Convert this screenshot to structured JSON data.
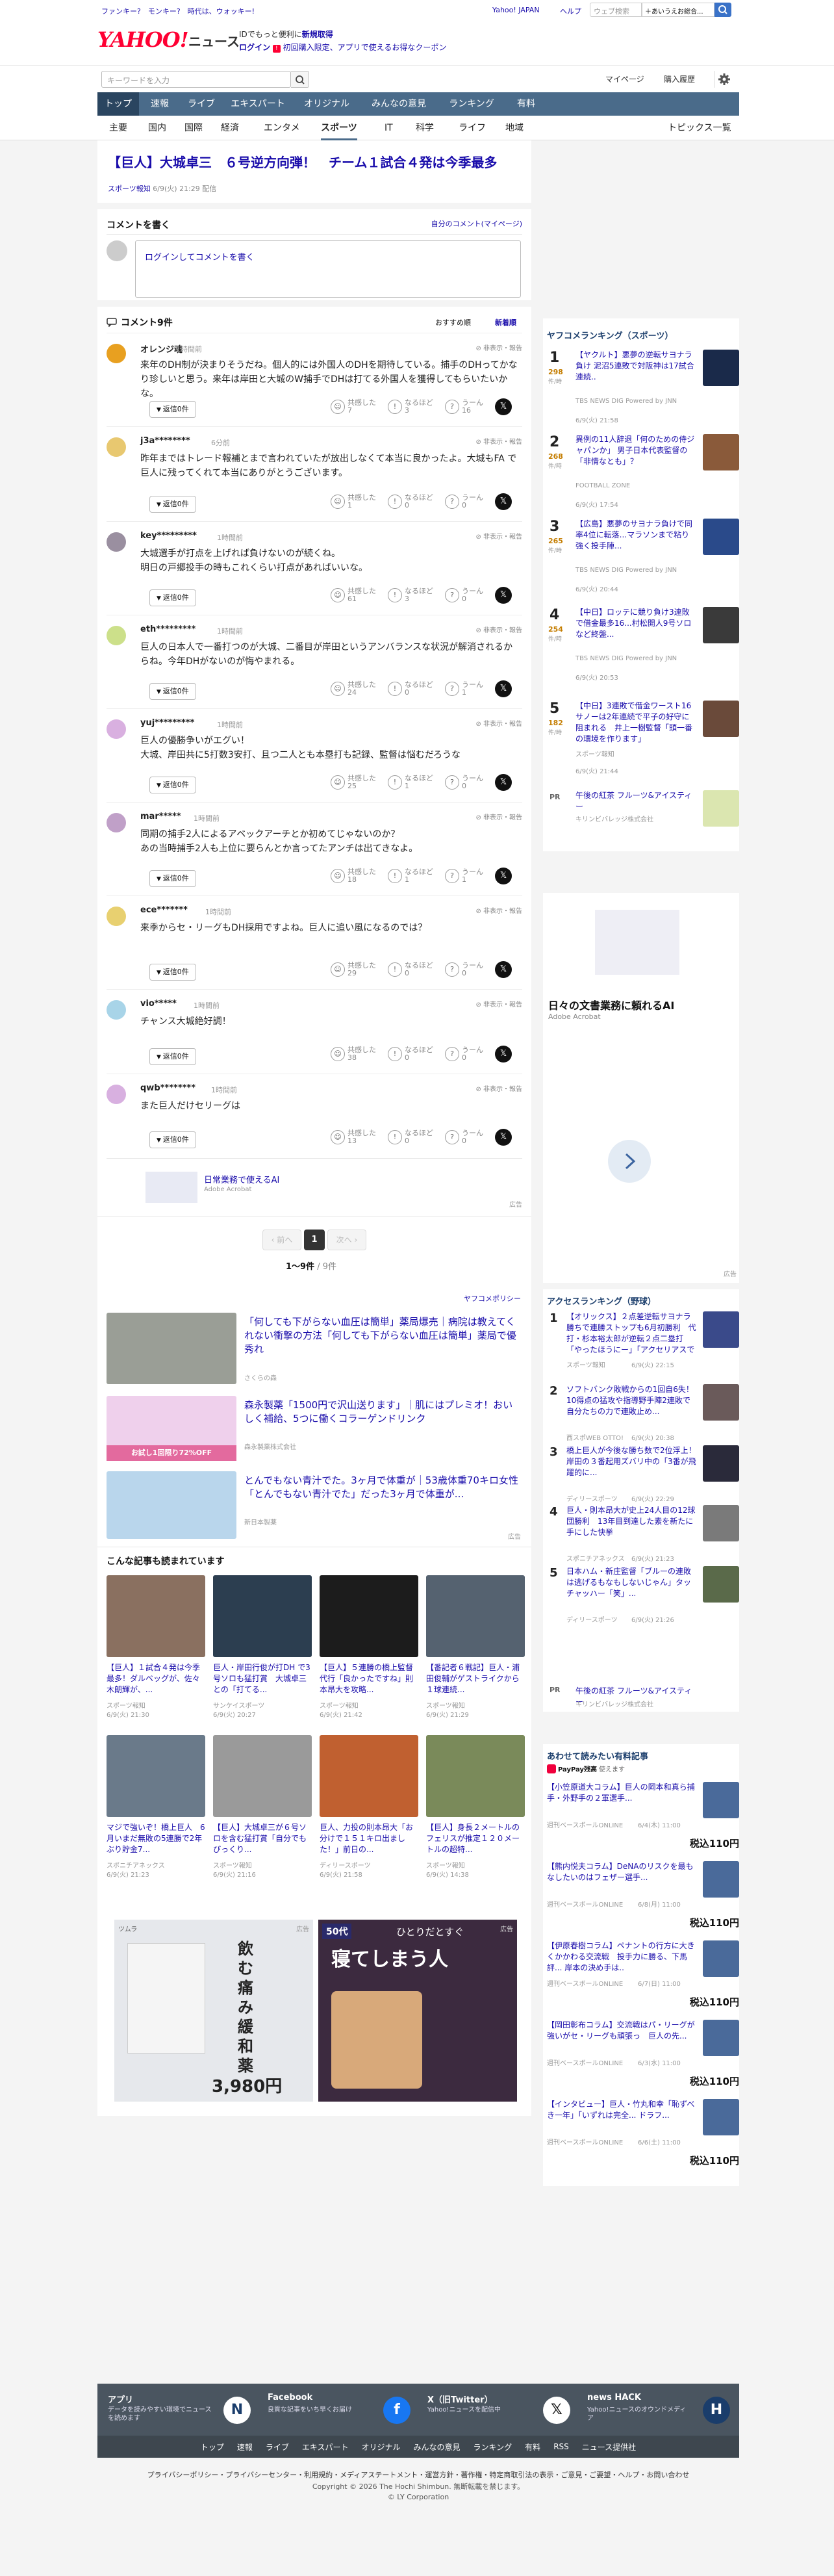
{
  "colors": {
    "nav": "#4a6b8a",
    "nav_active": "#2a4560",
    "brand": "#ff0033",
    "link": "#1a0dab",
    "rank_accent": "#c47d00",
    "footer": "#4a5560"
  },
  "topbar": {
    "promo": "ファンキー?　モンキー?　時代は、ウォッキー!",
    "links": [
      "Yahoo! JAPAN",
      "ヘルプ"
    ],
    "search_placeholder": "ウェブ検索",
    "search_select": "＋あいうえお総合...",
    "search_icon": "search-icon"
  },
  "header": {
    "logo": "YAHOO!",
    "logo_service": "ニュース",
    "promo_line1": "IDでもっと便利に",
    "promo_line1_em": "新規取得",
    "login_label": "ログイン",
    "promo_line2": "初回購入限定、アプリで使えるお得なクーポン"
  },
  "searchbar": {
    "placeholder": "キーワードを入力",
    "mypage": "マイページ",
    "purchase": "購入履歴",
    "settings_icon": "gear-icon"
  },
  "nav": [
    "トップ",
    "速報",
    "ライブ",
    "エキスパート",
    "オリジナル",
    "みんなの意見",
    "ランキング",
    "有料"
  ],
  "subnav": [
    "主要",
    "国内",
    "国際",
    "経済",
    "エンタメ",
    "スポーツ",
    "IT",
    "科学",
    "ライフ",
    "地域"
  ],
  "subnav_right": "トピックス一覧",
  "article": {
    "title": "【巨人】大城卓三　６号逆方向弾！　チーム１試合４発は今季最多",
    "source": "スポーツ報知",
    "date": "6/9(火) 21:29 配信"
  },
  "comment_form": {
    "heading": "コメントを書く",
    "my_comments": "自分のコメント(マイページ)",
    "login_prompt": "ログインしてコメントを書く"
  },
  "comments_header": {
    "title": "コメント9件",
    "sort_recommended": "おすすめ順",
    "sort_new": "新着順"
  },
  "comments": [
    {
      "name": "オレンジ魂",
      "time": "1時間前",
      "body": [
        "来年のDH制が決まりそうだね。個人的には外国人のDHを期待している。捕手のDHってかなり珍しいと思う。来年は岸田と大城のW捕手でDHは打てる外国人を獲得してもらいたいかな。"
      ],
      "agree": "7",
      "nahoto": "3",
      "unn": "16",
      "reply": "返信0件",
      "menu": "非表示・報告"
    },
    {
      "name": "j3a********",
      "time": "6分前",
      "body": [
        "昨年まではトレード報補とまで言われていたが放出しなくて本当に良かったよ。大城もFA で巨人に残ってくれて本当にありがとうございます。"
      ],
      "agree": "1",
      "nahoto": "0",
      "unn": "0",
      "reply": "返信0件",
      "menu": "非表示・報告"
    },
    {
      "name": "key*********",
      "time": "1時間前",
      "body": [
        "大城選手が打点を上げれば負けないのが続くね。",
        "明日の戸郷投手の時もこれくらい打点があればいいな。"
      ],
      "agree": "61",
      "nahoto": "3",
      "unn": "0",
      "reply": "返信0件",
      "menu": "非表示・報告"
    },
    {
      "name": "eth*********",
      "time": "1時間前",
      "body": [
        "巨人の日本人で一番打つのが大城、二番目が岸田というアンバランスな状況が解消されるからね。今年DHがないのが悔やまれる。"
      ],
      "agree": "24",
      "nahoto": "0",
      "unn": "1",
      "reply": "返信0件",
      "menu": "非表示・報告"
    },
    {
      "name": "yuj*********",
      "time": "1時間前",
      "body": [
        "巨人の優勝争いがエグい！",
        "大城、岸田共に5打数3安打、且つ二人とも本塁打も記録、監督は悩むだろうな"
      ],
      "agree": "25",
      "nahoto": "1",
      "unn": "0",
      "reply": "返信0件",
      "menu": "非表示・報告"
    },
    {
      "name": "mar*****",
      "time": "1時間前",
      "body": [
        "同期の捕手2人によるアベックアーチとか初めてじゃないのか？",
        "あの当時捕手2人も上位に要らんとか言ってたアンチは出てきなよ。"
      ],
      "agree": "18",
      "nahoto": "1",
      "unn": "1",
      "reply": "返信0件",
      "menu": "非表示・報告"
    },
    {
      "name": "ece*******",
      "time": "1時間前",
      "body": [
        "来季からセ・リーグもDH採用ですよね。巨人に追い風になるのでは？"
      ],
      "agree": "29",
      "nahoto": "0",
      "unn": "0",
      "reply": "返信0件",
      "menu": "非表示・報告"
    },
    {
      "name": "vio*****",
      "time": "1時間前",
      "body": [
        "チャンス大城絶好調！"
      ],
      "agree": "38",
      "nahoto": "0",
      "unn": "0",
      "reply": "返信0件",
      "menu": "非表示・報告"
    },
    {
      "name": "qwb********",
      "time": "1時間前",
      "body": [
        "また巨人だけセリーグは"
      ],
      "agree": "13",
      "nahoto": "0",
      "unn": "0",
      "reply": "返信0件",
      "menu": "非表示・報告"
    }
  ],
  "reaction_labels": {
    "agree": "共感した",
    "nahoto": "なるほど",
    "unn": "うーん"
  },
  "inline_ad": {
    "title": "日常業務で使えるAI",
    "source": "Adobe Acrobat",
    "ad_label": "広告"
  },
  "pagination": {
    "prev": "前へ",
    "current": "1",
    "next": "次へ",
    "summary": "1〜9件",
    "total": "/ 9件"
  },
  "yahoo_policy": "ヤフコメポリシー",
  "promos": [
    {
      "title": "「何しても下がらない血圧は簡単」薬局爆売｜病院は教えてくれない衝撃の方法「何しても下がらない血圧は簡単」薬局で優秀れ",
      "source": "さくらの森"
    },
    {
      "title": "森永製薬「1500円で沢山送ります」｜肌にはプレミオ！おいしく補給、5つに働くコラーゲンドリンク",
      "source": "森永製薬株式会社",
      "badge": "お試し1回限り72%OFF"
    },
    {
      "title": "とんでもない青汁でた。3ヶ月で体重が｜53歳体重70キロ女性「とんでもない青汁でた」だった3ヶ月で体重が...",
      "source": "新日本製薬"
    }
  ],
  "promo_ad_label": "広告",
  "related": {
    "heading": "こんな記事も読まれています",
    "items": [
      {
        "title": "【巨人】１試合４発は今季最多！ダルベッグが、佐々木朗輝が、...",
        "src": "スポーツ報知",
        "date": "6/9(火) 21:30"
      },
      {
        "title": "巨人・岸田行俊が打DH で3号ソロも猛打賞　大城卓三との「打てる...",
        "src": "サンケイスポーツ",
        "date": "6/9(火) 20:27"
      },
      {
        "title": "【巨人】５連勝の橋上監督代行「良かったですね」則本昂大を攻略...",
        "src": "スポーツ報知",
        "date": "6/9(火) 21:42"
      },
      {
        "title": "【番記者６戦記】巨人・浦田俊輔がゲストライクから１球連続...",
        "src": "スポーツ報知",
        "date": "6/9(火) 21:29"
      },
      {
        "title": "マジで強いぞ！橋上巨人　6月いまだ無敗の5連勝で2年ぶり貯金7...",
        "src": "スポニチアネックス",
        "date": "6/9(火) 21:23"
      },
      {
        "title": "【巨人】大城卓三が６号ソロを含む猛打賞「自分でもびっくり...",
        "src": "スポーツ報知",
        "date": "6/9(火) 21:16"
      },
      {
        "title": "巨人、力投の則本昂大「お分けで１５１キロ出ました！」前日の...",
        "src": "ディリースポーツ",
        "date": "6/9(火) 21:58"
      },
      {
        "title": "【巨人】身長２メートルのフェリスが推定１２０メートルの超特...",
        "src": "スポーツ報知",
        "date": "6/9(火) 14:38"
      }
    ]
  },
  "bottom_ads": [
    {
      "label": "広告",
      "brand": "ツムラ",
      "headline": "飲む痛み緩和薬",
      "price": "3,980円"
    },
    {
      "label": "広告",
      "age": "50代",
      "headline": "寝てしまう人",
      "sub": "ひとりだとすぐ"
    }
  ],
  "sidebar_ranking": {
    "heading": "ヤフコメランキング（スポーツ）",
    "unit": "件/時",
    "items": [
      {
        "rank": "1",
        "count": "298",
        "title": "【ヤクルト】悪夢の逆転サヨナラ負け 泥沼5連敗で対阪神は17試合連続..",
        "src": "TBS NEWS DIG Powered by JNN",
        "date": "6/9(火) 21:58"
      },
      {
        "rank": "2",
        "count": "268",
        "title": "異例の11人辞退「何のための侍ジャパンか」 男子日本代表監督の「非情なとも」？",
        "src": "FOOTBALL ZONE",
        "date": "6/9(火) 17:54"
      },
      {
        "rank": "3",
        "count": "265",
        "title": "【広島】悪夢のサヨナラ負けで同率4位に転落...マラソンまで粘り強く投手陣...",
        "src": "TBS NEWS DIG Powered by JNN",
        "date": "6/9(火) 20:44"
      },
      {
        "rank": "4",
        "count": "254",
        "title": "【中日】ロッテに競り負け3連敗で借金最多16...村松開人9号ソロなど終盤...",
        "src": "TBS NEWS DIG Powered by JNN",
        "date": "6/9(火) 20:53"
      },
      {
        "rank": "5",
        "count": "182",
        "title": "【中日】3連敗で借金ワースト16　サノーは2年連続で平子の好守に阻まれる　井上一樹監督「頭一番の環境を作ります」",
        "src": "スポーツ報知",
        "date": "6/9(火) 21:44"
      }
    ],
    "pr": {
      "title": "午後の紅茶 フルーツ&アイスティー",
      "src": "キリンビバレッジ株式会社"
    }
  },
  "sidebar_ad": {
    "title": "日々の文書業務に頼れるAI",
    "source": "Adobe Acrobat",
    "label": "広告"
  },
  "sidebar_ranking2": {
    "heading": "アクセスランキング（野球）",
    "items": [
      {
        "rank": "1",
        "title": "【オリックス】２点差逆転サヨナラ勝ちで連勝ストップも6月初勝利　代打・杉本裕太郎が逆転２点二塁打「やったほうにー」「アクセリアスでくださいんですよ」...",
        "src": "スポーツ報知",
        "date": "6/9(火) 22:15"
      },
      {
        "rank": "2",
        "title": "ソフトバンク敗戦からの1回自6失！　10得点の猛攻や指導野手陣2連敗で自分たちの力で連敗止め...",
        "src": "西スポWEB OTTO!",
        "date": "6/9(火) 20:38"
      },
      {
        "rank": "3",
        "title": "橋上巨人が今後な勝ち数で2位浮上！岸田の３番起用ズバリ中の「3番が飛躍的に...",
        "src": "ディリースポーツ",
        "date": "6/9(火) 22:29"
      },
      {
        "rank": "4",
        "title": "巨人・則本昂大が史上24人目の12球団勝利　13年目到達した素を新たに手にした快挙",
        "src": "スポニチアネックス",
        "date": "6/9(火) 21:23"
      },
      {
        "rank": "5",
        "title": "日本ハム・新庄監督「ブルーの連敗は逃げるもなもしないじゃん」タッチャッハー「笑」...",
        "src": "ディリースポーツ",
        "date": "6/9(火) 21:26"
      }
    ],
    "pr": {
      "title": "午後の紅茶 フルーツ&アイスティー",
      "src": "キリンビバレッジ株式会社"
    }
  },
  "sidebar_paid": {
    "heading": "あわせて読みたい有料記事",
    "badge": "PayPay残高",
    "badge_suffix": "使えます",
    "items": [
      {
        "title": "【小笠原道大コラム】巨人の岡本和真ら捕手・外野手の２軍選手...",
        "src": "週刊ベースボールONLINE",
        "date": "6/4(木) 11:00",
        "price": "税込110円"
      },
      {
        "title": "【熊内悦夫コラム】DeNAのリスクを最もなしたいのはフェザー選手...",
        "src": "週刊ベースボールONLINE",
        "date": "6/8(月) 11:00",
        "price": "税込110円"
      },
      {
        "title": "【伊原春樹コラム】ペナントの行方に大きくかかわる交流戦　投手力に勝る、下馬評... 岸本の決め手は..",
        "src": "週刊ベースボールONLINE",
        "date": "6/7(日) 11:00",
        "price": "税込110円"
      },
      {
        "title": "【岡田彰布コラム】交流戦はパ・リーグが強いがセ・リーグも頑張っ　巨人の先...",
        "src": "週刊ベースボールONLINE",
        "date": "6/3(水) 11:00",
        "price": "税込110円"
      },
      {
        "title": "【インタビュー】巨人・竹丸和幸「恥ずべき一年」「いずれは完全... ドラフ...",
        "src": "週刊ベースボールONLINE",
        "date": "6/6(土) 11:00",
        "price": "税込110円"
      }
    ]
  },
  "footer_apps": [
    {
      "name": "アプリ",
      "desc": "データを読みやすい環境でニュースを読めます"
    },
    {
      "name": "Facebook",
      "desc": "良質な記事をいち早くお届け"
    },
    {
      "name": "X（旧Twitter）",
      "desc": "Yahoo!ニュースを配信中"
    },
    {
      "name": "news HACK",
      "desc": "Yahoo!ニュースのオウンドメディア"
    }
  ],
  "footer_nav": [
    "トップ",
    "速報",
    "ライブ",
    "エキスパート",
    "オリジナル",
    "みんなの意見",
    "ランキング",
    "有料",
    "RSS",
    "ニュース提供社"
  ],
  "footer_links": "プライバシーポリシー・プライバシーセンター・利用規約・メディアステートメント・運営方針・著作権・特定商取引法の表示・ご意見・ご要望・ヘルプ・お問い合わせ",
  "copyright": "Copyright © 2026 The Hochi Shimbun. 無断転載を禁じます。",
  "lycorp": "© LY Corporation"
}
